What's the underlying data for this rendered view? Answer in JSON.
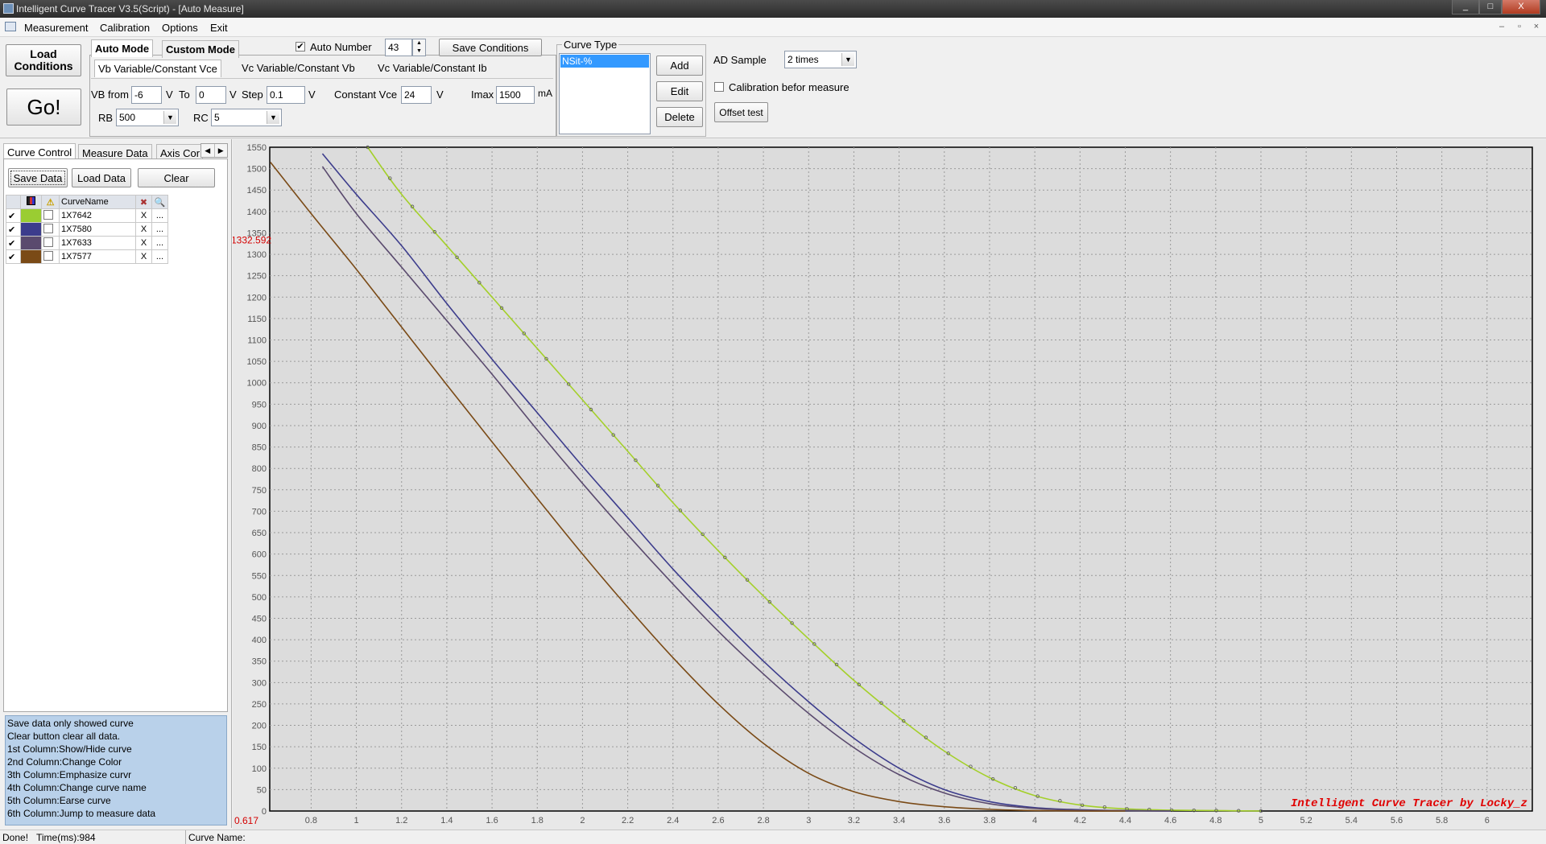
{
  "window": {
    "title": "Intelligent Curve Tracer V3.5(Script) - [Auto Measure]",
    "controls": [
      "_",
      "□",
      "X"
    ]
  },
  "menu": [
    "Measurement",
    "Calibration",
    "Options",
    "Exit"
  ],
  "mdi_controls": [
    "–",
    "▫",
    "×"
  ],
  "toolbar": {
    "load_conditions": "Load\nConditions",
    "go": "Go!",
    "mode_tabs": [
      "Auto Mode",
      "Custom Mode"
    ],
    "auto_number_label": "Auto Number",
    "auto_number_checked": true,
    "auto_number_value": "43",
    "save_conditions": "Save Conditions",
    "sub_tabs": [
      "Vb Variable/Constant Vce",
      "Vc Variable/Constant Vb",
      "Vc Variable/Constant Ib"
    ],
    "vb_from_label": "VB from",
    "vb_from_value": "-6",
    "vb_from_unit": "V",
    "to_label": "To",
    "to_value": "0",
    "to_unit": "V",
    "step_label": "Step",
    "step_value": "0.1",
    "step_unit": "V",
    "const_vce_label": "Constant Vce",
    "const_vce_value": "24",
    "const_vce_unit": "V",
    "imax_label": "Imax",
    "imax_value": "1500",
    "imax_unit": "mA",
    "rb_label": "RB",
    "rb_value": "500",
    "rc_label": "RC",
    "rc_value": "5"
  },
  "curve_type": {
    "title": "Curve Type",
    "items": [
      "NSit-%"
    ],
    "add": "Add",
    "edit": "Edit",
    "delete": "Delete"
  },
  "ad_sample": {
    "label": "AD Sample",
    "value": "2 times",
    "calibration_label": "Calibration befor measure",
    "calibration_checked": false,
    "offset_test": "Offset test"
  },
  "left_panel": {
    "tabs": [
      "Curve Control",
      "Measure Data",
      "Axis Cor"
    ],
    "save_data": "Save Data",
    "load_data": "Load Data",
    "clear": "Clear",
    "column_header": "CurveName",
    "curves": [
      {
        "name": "1X7642",
        "color": "#9acd32",
        "shown": true
      },
      {
        "name": "1X7580",
        "color": "#3c3c8c",
        "shown": true
      },
      {
        "name": "1X7633",
        "color": "#5a4a6e",
        "shown": true
      },
      {
        "name": "1X7577",
        "color": "#7a4a16",
        "shown": true
      }
    ],
    "erase_label": "X",
    "jump_label": "...",
    "notes": [
      "  Save data only showed curve",
      "  Clear button clear all data.",
      "1st Column:Show/Hide curve",
      "2nd Column:Change Color",
      "3th Column:Emphasize curvr",
      "4th Column:Change curve name",
      "5th Column:Earse curve",
      "6th Column:Jump to measure data"
    ]
  },
  "chart_data": {
    "type": "line",
    "xlim": [
      0.617,
      6.2
    ],
    "ylim": [
      0,
      1550
    ],
    "x_ticks": [
      0.8,
      1,
      1.2,
      1.4,
      1.6,
      1.8,
      2,
      2.2,
      2.4,
      2.6,
      2.8,
      3,
      3.2,
      3.4,
      3.6,
      3.8,
      4,
      4.2,
      4.4,
      4.6,
      4.8,
      5,
      5.2,
      5.4,
      5.6,
      5.8,
      6
    ],
    "y_ticks": [
      0,
      50,
      100,
      150,
      200,
      250,
      300,
      350,
      400,
      450,
      500,
      550,
      600,
      650,
      700,
      750,
      800,
      850,
      900,
      950,
      1000,
      1050,
      1100,
      1150,
      1200,
      1250,
      1300,
      1350,
      1400,
      1450,
      1500,
      1550
    ],
    "x_origin_label": "0.617",
    "cursor_y_label": "1332.592",
    "cursor_y_value": 1332.592,
    "grid": true,
    "watermark": "Intelligent Curve Tracer by Locky_z",
    "series": [
      {
        "name": "1X7642",
        "color": "#a4d02a",
        "markers": true,
        "x": [
          1.05,
          1.2,
          1.4,
          1.6,
          1.8,
          2.0,
          2.2,
          2.4,
          2.6,
          2.8,
          3.0,
          3.2,
          3.4,
          3.6,
          3.8,
          4.0,
          4.2,
          4.4,
          4.6,
          4.8,
          5.0
        ],
        "y": [
          1550,
          1440,
          1320,
          1200,
          1080,
          960,
          840,
          720,
          608,
          502,
          402,
          305,
          218,
          140,
          78,
          36,
          14,
          5,
          2,
          1,
          0
        ]
      },
      {
        "name": "1X7580",
        "color": "#3c3c8c",
        "markers": false,
        "x": [
          0.85,
          1.0,
          1.2,
          1.4,
          1.6,
          1.8,
          2.0,
          2.2,
          2.4,
          2.6,
          2.8,
          3.0,
          3.2,
          3.4,
          3.6,
          3.8,
          4.0,
          4.2,
          4.4,
          4.6
        ],
        "y": [
          1535,
          1440,
          1320,
          1185,
          1055,
          930,
          805,
          685,
          565,
          455,
          350,
          255,
          170,
          100,
          50,
          22,
          8,
          3,
          1,
          0
        ]
      },
      {
        "name": "1X7633",
        "color": "#5a4a6e",
        "markers": false,
        "x": [
          0.85,
          1.0,
          1.2,
          1.4,
          1.6,
          1.8,
          2.0,
          2.2,
          2.4,
          2.6,
          2.8,
          3.0,
          3.2,
          3.4,
          3.6,
          3.8,
          4.0,
          4.2,
          4.4,
          4.6
        ],
        "y": [
          1505,
          1395,
          1270,
          1145,
          1020,
          890,
          765,
          645,
          530,
          420,
          320,
          228,
          148,
          85,
          42,
          17,
          6,
          2,
          1,
          0
        ]
      },
      {
        "name": "1X7577",
        "color": "#7a4a16",
        "markers": false,
        "x": [
          0.62,
          0.8,
          1.0,
          1.2,
          1.4,
          1.6,
          1.8,
          2.0,
          2.2,
          2.4,
          2.6,
          2.8,
          3.0,
          3.2,
          3.4,
          3.6,
          3.8,
          4.0,
          4.2,
          4.4
        ],
        "y": [
          1515,
          1395,
          1265,
          1130,
          995,
          862,
          730,
          600,
          476,
          358,
          250,
          158,
          88,
          45,
          22,
          10,
          4,
          1,
          0,
          0
        ]
      }
    ]
  },
  "status": {
    "left": "Done!",
    "time": "Time(ms):984",
    "curve_name_label": "Curve Name:"
  }
}
